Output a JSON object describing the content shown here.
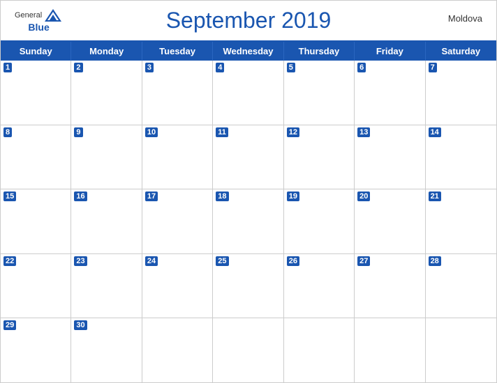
{
  "header": {
    "title": "September 2019",
    "country": "Moldova",
    "logo": {
      "general": "General",
      "blue": "Blue"
    }
  },
  "days_of_week": [
    "Sunday",
    "Monday",
    "Tuesday",
    "Wednesday",
    "Thursday",
    "Friday",
    "Saturday"
  ],
  "weeks": [
    [
      1,
      2,
      3,
      4,
      5,
      6,
      7
    ],
    [
      8,
      9,
      10,
      11,
      12,
      13,
      14
    ],
    [
      15,
      16,
      17,
      18,
      19,
      20,
      21
    ],
    [
      22,
      23,
      24,
      25,
      26,
      27,
      28
    ],
    [
      29,
      30,
      null,
      null,
      null,
      null,
      null
    ]
  ],
  "colors": {
    "header_bg": "#1a56b0",
    "header_text": "#ffffff",
    "title_color": "#1a56b0"
  }
}
